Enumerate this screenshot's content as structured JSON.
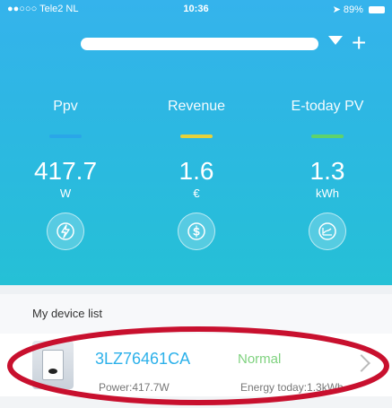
{
  "status_bar": {
    "carrier": "●●○○○ Tele2 NL",
    "time": "10:36",
    "battery": "89%",
    "icons": [
      "wifi-icon",
      "location-icon",
      "alarm-icon",
      "bluetooth-icon",
      "battery-icon"
    ]
  },
  "header": {
    "station_name": "",
    "icons": [
      "chevron-down-icon",
      "plus-icon"
    ]
  },
  "metrics": [
    {
      "label": "Ppv",
      "value": "417.7",
      "unit": "W",
      "icon": "lightning-icon",
      "accent": "#2aa6e8"
    },
    {
      "label": "Revenue",
      "value": "1.6",
      "unit": "€",
      "icon": "dollar-icon",
      "accent": "#e5d23b"
    },
    {
      "label": "E-today PV",
      "value": "1.3",
      "unit": "kWh",
      "icon": "chart-icon",
      "accent": "#5fd36b"
    }
  ],
  "device_list": {
    "title": "My device list",
    "devices": [
      {
        "id": "3LZ76461CA",
        "status": "Normal",
        "power": "Power:417.7W",
        "energy": "Energy today:1.3kWh",
        "status_color": "#7fd27f"
      }
    ]
  },
  "colors": {
    "hero_top": "#35b3ec",
    "hero_bottom": "#25c0d6",
    "device_id": "#2db1ea",
    "annotation": "#c8102e"
  }
}
